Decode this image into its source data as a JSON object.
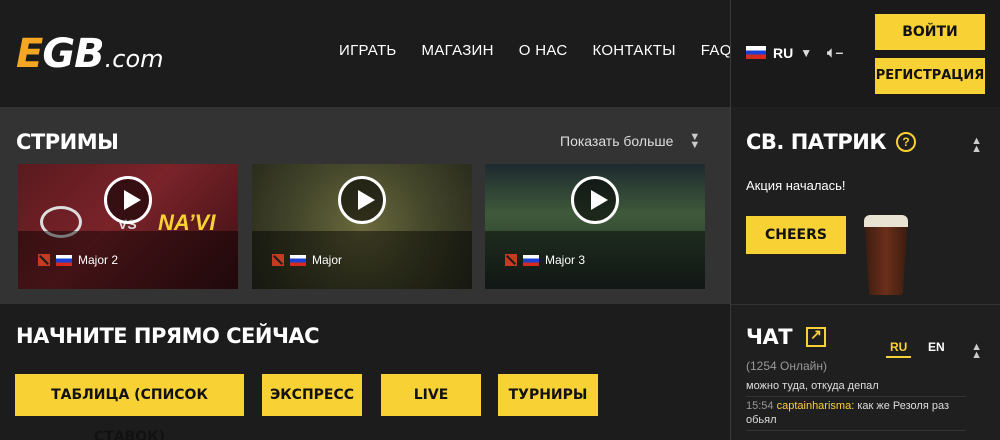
{
  "header": {
    "logo_main": "GB",
    "logo_e": "E",
    "logo_suffix": ".com",
    "nav": [
      "ИГРАТЬ",
      "МАГАЗИН",
      "О НАС",
      "КОНТАКТЫ",
      "FAQ"
    ],
    "lang": "RU",
    "login_label": "ВОЙТИ",
    "register_label": "РЕГИСТРАЦИЯ"
  },
  "streams": {
    "title": "СТРИМЫ",
    "show_more": "Показать больше",
    "items": [
      {
        "name": "Major 2",
        "game": "dota-icon",
        "flag": "ru"
      },
      {
        "name": "Major",
        "game": "dota-icon",
        "flag": "ru"
      },
      {
        "name": "Major 3",
        "game": "dota-icon",
        "flag": "ru"
      }
    ],
    "thumb1_vs": "VS"
  },
  "start": {
    "title": "НАЧНИТЕ ПРЯМО СЕЙЧАС",
    "buttons": [
      "ТАБЛИЦА (СПИСОК СТАВОК)",
      "ЭКСПРЕСС",
      "LIVE",
      "ТУРНИРЫ"
    ]
  },
  "promo": {
    "title": "СВ. ПАТРИК",
    "help": "?",
    "text": "Акция началась!",
    "cta": "CHEERS"
  },
  "chat": {
    "title": "ЧАТ",
    "online": "(1254 Онлайн)",
    "langs": [
      "RU",
      "EN"
    ],
    "active_lang": "RU",
    "messages": [
      {
        "time": "",
        "user": "",
        "text": "можно туда, откуда депал"
      },
      {
        "time": "15:54",
        "user": "captainharisma:",
        "text": "как же Резоля раз обьял"
      }
    ]
  },
  "colors": {
    "accent": "#f8d134",
    "logo_e": "#f5a623",
    "streams_bg": "#333333",
    "page_bg": "#1c1c1c"
  }
}
